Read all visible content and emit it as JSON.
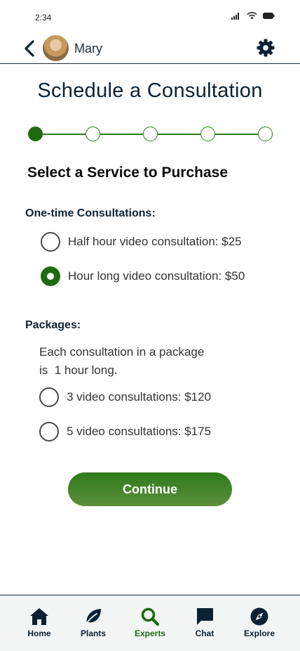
{
  "status_bar": {
    "time": "2:34"
  },
  "header": {
    "user_name": "Mary"
  },
  "page": {
    "title": "Schedule a Consultation",
    "steps_total": 5,
    "current_step": 1
  },
  "service": {
    "heading": "Select a Service to Purchase",
    "one_time": {
      "label": "One-time Consultations:",
      "options": [
        {
          "label": "Half hour video consultation: $25",
          "selected": false
        },
        {
          "label": "Hour long video consultation: $50",
          "selected": true
        }
      ]
    },
    "packages": {
      "label": "Packages:",
      "note_line1": "Each consultation in a package",
      "note_line2": "is  1 hour long.",
      "options": [
        {
          "label": "3 video consultations: $120",
          "selected": false
        },
        {
          "label": "5 video consultations: $175",
          "selected": false
        }
      ]
    }
  },
  "continue_label": "Continue",
  "nav": {
    "items": [
      {
        "label": "Home",
        "icon": "home-icon"
      },
      {
        "label": "Plants",
        "icon": "leaf-icon"
      },
      {
        "label": "Experts",
        "icon": "search-icon",
        "active": true
      },
      {
        "label": "Chat",
        "icon": "chat-icon"
      },
      {
        "label": "Explore",
        "icon": "compass-icon"
      }
    ]
  },
  "colors": {
    "brand_green": "#1f6a10",
    "navy": "#0c2234"
  }
}
